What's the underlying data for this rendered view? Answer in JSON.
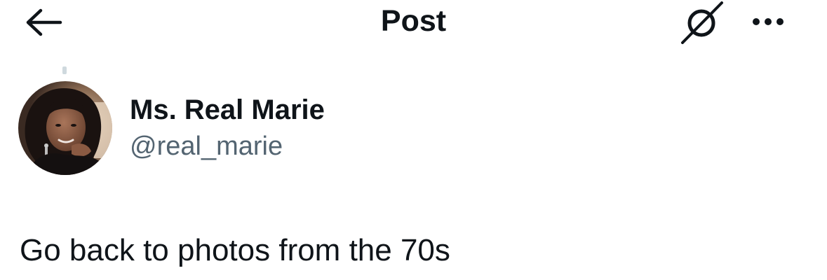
{
  "header": {
    "title": "Post",
    "back_icon": "arrow-left-icon",
    "grok_icon": "grok-slash-circle-icon",
    "more_icon": "ellipsis-horizontal-icon"
  },
  "author": {
    "display_name": "Ms. Real Marie",
    "handle": "@real_marie",
    "avatar_icon": "profile-photo"
  },
  "post": {
    "text": "Go back to photos from the 70s"
  },
  "colors": {
    "text_primary": "#0f1419",
    "text_secondary": "#536471",
    "thread_line": "#cfd9de",
    "background": "#ffffff"
  }
}
